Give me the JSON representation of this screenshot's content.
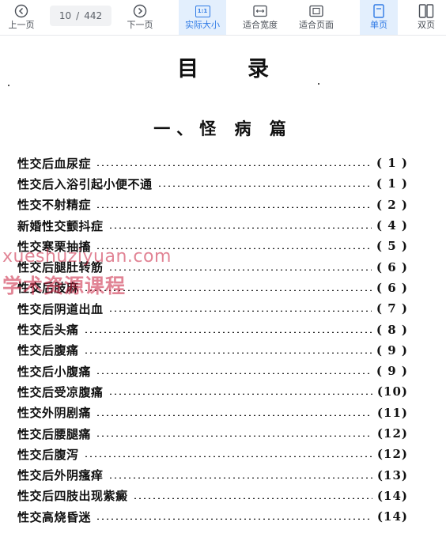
{
  "toolbar": {
    "prev_label": "上一页",
    "next_label": "下一页",
    "current_page": "10",
    "separator": "/",
    "total_pages": "442",
    "actual_size_label": "实际大小",
    "actual_size_icon_text": "1:1",
    "fit_width_label": "适合宽度",
    "fit_page_label": "适合页面",
    "single_page_label": "单页",
    "double_page_label": "双页",
    "accent_color": "#2f7ae5"
  },
  "document": {
    "title": "目录",
    "section_title": "一、怪 病 篇",
    "toc": [
      {
        "title": "性交后血尿症",
        "page": "( 1 )"
      },
      {
        "title": "性交后入浴引起小便不通",
        "page": "( 1 )"
      },
      {
        "title": "性交不射精症",
        "page": "( 2 )"
      },
      {
        "title": "新婚性交颤抖症",
        "page": "( 4 )"
      },
      {
        "title": "性交寒栗抽搐",
        "page": "( 5 )"
      },
      {
        "title": "性交后腿肚转筋",
        "page": "( 6 )"
      },
      {
        "title": "性交后肢麻",
        "page": "( 6 )"
      },
      {
        "title": "性交后阴道出血",
        "page": "( 7 )"
      },
      {
        "title": "性交后头痛",
        "page": "( 8 )"
      },
      {
        "title": "性交后腹痛",
        "page": "( 9 )"
      },
      {
        "title": "性交后小腹痛",
        "page": "( 9 )"
      },
      {
        "title": "性交后受凉腹痛",
        "page": "(10)"
      },
      {
        "title": "性交外阴剧痛",
        "page": "(11)"
      },
      {
        "title": "性交后腰腿痛",
        "page": "(12)"
      },
      {
        "title": "性交后腹泻",
        "page": "(12)"
      },
      {
        "title": "性交后外阴瘙痒",
        "page": "(13)"
      },
      {
        "title": "性交后四肢出现紫癜",
        "page": "(14)"
      },
      {
        "title": "性交高烧昏迷",
        "page": "(14)"
      }
    ]
  },
  "watermark": {
    "line1": "xueshuziyuan.com",
    "line2": "学术资源课程",
    "color": "#c81e3c"
  }
}
